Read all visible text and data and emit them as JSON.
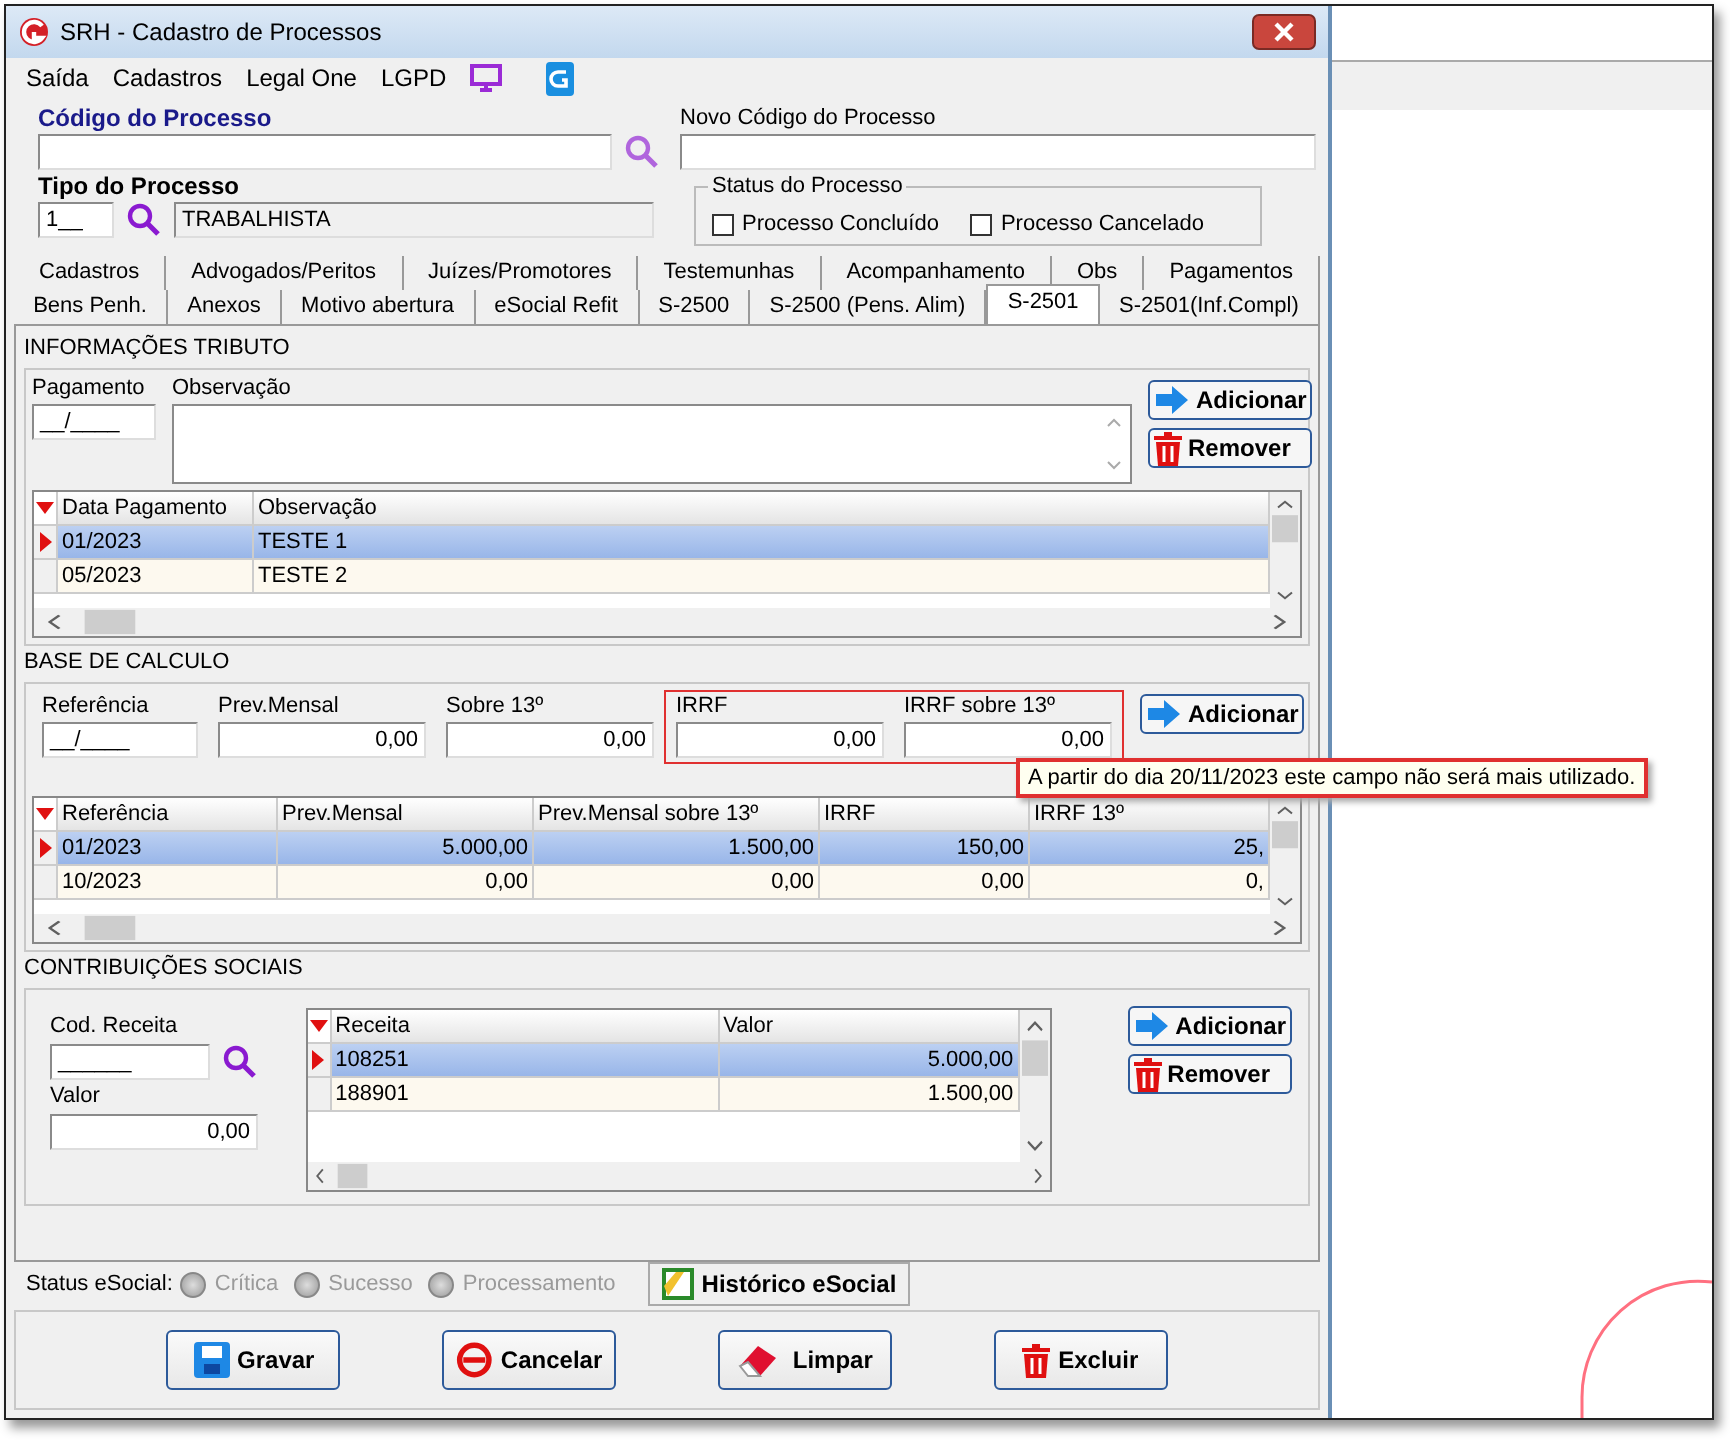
{
  "window": {
    "title": "SRH - Cadastro de Processos"
  },
  "menu": [
    {
      "label": "Saída"
    },
    {
      "label": "Cadastros"
    },
    {
      "label": "Legal One"
    },
    {
      "label": "LGPD"
    }
  ],
  "codigo_processo": {
    "label": "Código do Processo"
  },
  "novo_codigo": {
    "label": "Novo Código do Processo"
  },
  "tipo_processo": {
    "label": "Tipo do Processo",
    "code": "1__",
    "description": "TRABALHISTA"
  },
  "status_processo": {
    "title": "Status do Processo",
    "options": [
      {
        "label": "Processo Concluído",
        "checked": false
      },
      {
        "label": "Processo Cancelado",
        "checked": false
      }
    ]
  },
  "tabs_row1": [
    {
      "label": "Cadastros",
      "selected": false
    },
    {
      "label": "Advogados/Peritos",
      "selected": false
    },
    {
      "label": "Juízes/Promotores",
      "selected": false
    },
    {
      "label": "Testemunhas",
      "selected": false
    },
    {
      "label": "Acompanhamento",
      "selected": false
    },
    {
      "label": "Obs",
      "selected": false
    },
    {
      "label": "Pagamentos",
      "selected": false
    }
  ],
  "tabs_row2": [
    {
      "label": "Bens Penh.",
      "selected": false
    },
    {
      "label": "Anexos",
      "selected": false
    },
    {
      "label": "Motivo abertura",
      "selected": false
    },
    {
      "label": "eSocial Refit",
      "selected": false
    },
    {
      "label": "S-2500",
      "selected": false
    },
    {
      "label": "S-2500 (Pens. Alim)",
      "selected": false
    },
    {
      "label": "S-2501",
      "selected": true
    },
    {
      "label": "S-2501(Inf.Compl)",
      "selected": false
    }
  ],
  "informacoes_tributo": {
    "title": "INFORMAÇÕES TRIBUTO",
    "pagamento": {
      "label": "Pagamento",
      "value": "__/____"
    },
    "observacao": {
      "label": "Observação"
    },
    "buttons": [
      {
        "label": "Adicionar",
        "kind": "add"
      },
      {
        "label": "Remover",
        "kind": "remove"
      }
    ],
    "table": {
      "columns": [
        "Data Pagamento",
        "Observação"
      ],
      "rows": [
        {
          "cells": [
            "01/2023",
            "TESTE 1"
          ],
          "selected": true
        },
        {
          "cells": [
            "05/2023",
            "TESTE 2"
          ],
          "selected": false
        }
      ]
    }
  },
  "base_calculo": {
    "title": "BASE DE CALCULO",
    "fields": [
      {
        "label": "Referência",
        "value": "__/____",
        "highlighted": false
      },
      {
        "label": "Prev.Mensal",
        "value": "0,00",
        "highlighted": false
      },
      {
        "label": "Sobre 13º",
        "value": "0,00",
        "highlighted": false
      },
      {
        "label": "IRRF",
        "value": "0,00",
        "highlighted": true
      },
      {
        "label": "IRRF sobre  13º",
        "value": "0,00",
        "highlighted": true
      }
    ],
    "buttons": [
      {
        "label": "Adicionar",
        "kind": "add"
      }
    ],
    "tooltip": "A partir do dia 20/11/2023 este campo não será mais utilizado.",
    "table": {
      "columns": [
        "Referência",
        "Prev.Mensal",
        "Prev.Mensal sobre 13º",
        "IRRF",
        "IRRF 13º"
      ],
      "rows": [
        {
          "cells": [
            "01/2023",
            "5.000,00",
            "1.500,00",
            "150,00",
            "25,"
          ],
          "selected": true
        },
        {
          "cells": [
            "10/2023",
            "0,00",
            "0,00",
            "0,00",
            "0,"
          ],
          "selected": false
        }
      ]
    }
  },
  "contribuicoes_sociais": {
    "title": "CONTRIBUIÇÕES SOCIAIS",
    "cod_receita": {
      "label": "Cod. Receita",
      "value": "______"
    },
    "valor": {
      "label": "Valor",
      "value": "0,00"
    },
    "buttons": [
      {
        "label": "Adicionar",
        "kind": "add"
      },
      {
        "label": "Remover",
        "kind": "remove"
      }
    ],
    "table": {
      "columns": [
        "Receita",
        "Valor"
      ],
      "rows": [
        {
          "cells": [
            "108251",
            "5.000,00"
          ],
          "selected": true
        },
        {
          "cells": [
            "188901",
            "1.500,00"
          ],
          "selected": false
        }
      ]
    }
  },
  "status_esocial": {
    "label": "Status eSocial:",
    "options": [
      {
        "label": "Crítica",
        "disabled": true
      },
      {
        "label": "Sucesso",
        "disabled": true
      },
      {
        "label": "Processamento",
        "disabled": true
      }
    ],
    "history_button": "Histórico eSocial"
  },
  "footer_buttons": [
    {
      "label": "Gravar",
      "kind": "save"
    },
    {
      "label": "Cancelar",
      "kind": "cancel"
    },
    {
      "label": "Limpar",
      "kind": "clear"
    },
    {
      "label": "Excluir",
      "kind": "delete"
    }
  ]
}
